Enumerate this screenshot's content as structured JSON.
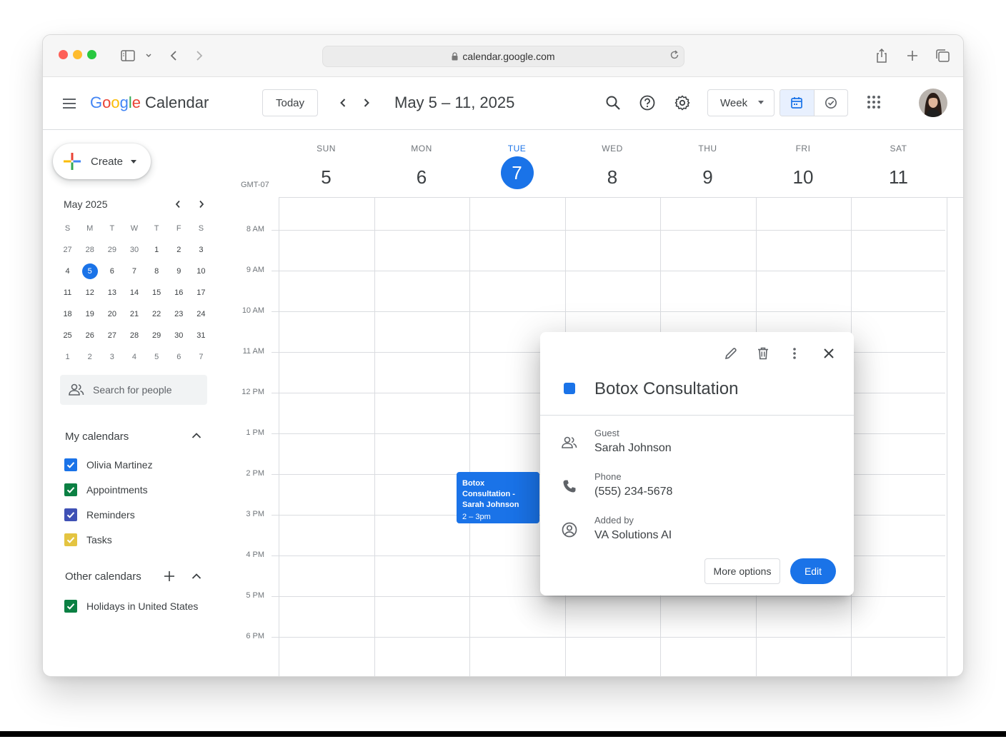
{
  "browser": {
    "url": "calendar.google.com"
  },
  "app": {
    "logo_letters": [
      "G",
      "o",
      "o",
      "g",
      "l",
      "e"
    ],
    "logo_colors": [
      "#4285F4",
      "#EA4335",
      "#FBBC05",
      "#4285F4",
      "#34A853",
      "#EA4335"
    ],
    "product": "Calendar",
    "accent": "#1a73e8"
  },
  "header": {
    "today_label": "Today",
    "date_range": "May 5 – 11, 2025",
    "view_label": "Week",
    "icons": [
      "menu-icon",
      "search-icon",
      "help-icon",
      "settings-icon",
      "calendar-view-icon",
      "tasks-view-icon",
      "apps-icon"
    ]
  },
  "sidebar": {
    "create_label": "Create",
    "mini_month": "May 2025",
    "mini_day_headers": [
      "S",
      "M",
      "T",
      "W",
      "T",
      "F",
      "S"
    ],
    "mini_weeks": [
      [
        "27",
        "28",
        "29",
        "30",
        "1",
        "2",
        "3"
      ],
      [
        "4",
        "5",
        "6",
        "7",
        "8",
        "9",
        "10"
      ],
      [
        "11",
        "12",
        "13",
        "14",
        "15",
        "16",
        "17"
      ],
      [
        "18",
        "19",
        "20",
        "21",
        "22",
        "23",
        "24"
      ],
      [
        "25",
        "26",
        "27",
        "28",
        "29",
        "30",
        "31"
      ],
      [
        "1",
        "2",
        "3",
        "4",
        "5",
        "6",
        "7"
      ]
    ],
    "mini_selected": "5",
    "people_placeholder": "Search for people",
    "my_calendars_title": "My calendars",
    "my_calendars": [
      {
        "name": "Olivia Martinez",
        "color": "#1a73e8"
      },
      {
        "name": "Appointments",
        "color": "#0b8043"
      },
      {
        "name": "Reminders",
        "color": "#3f51b5"
      },
      {
        "name": "Tasks",
        "color": "#e4c441"
      }
    ],
    "other_calendars_title": "Other calendars",
    "other_calendars": [
      {
        "name": "Holidays in United States",
        "color": "#0b8043"
      }
    ]
  },
  "week": {
    "timezone": "GMT-07",
    "days": [
      {
        "name": "SUN",
        "num": "5"
      },
      {
        "name": "MON",
        "num": "6"
      },
      {
        "name": "TUE",
        "num": "7",
        "today": true
      },
      {
        "name": "WED",
        "num": "8"
      },
      {
        "name": "THU",
        "num": "9"
      },
      {
        "name": "FRI",
        "num": "10"
      },
      {
        "name": "SAT",
        "num": "11"
      }
    ],
    "hours": [
      "8 AM",
      "9 AM",
      "10 AM",
      "11 AM",
      "12 PM",
      "1 PM",
      "2 PM",
      "3 PM",
      "4 PM",
      "5 PM",
      "6 PM"
    ]
  },
  "event": {
    "title_line1": "Botox Consultation -",
    "title_line2": "Sarah Johnson",
    "time": "2 – 3pm"
  },
  "popover": {
    "title": "Botox Consultation",
    "guest_label": "Guest",
    "guest_value": "Sarah Johnson",
    "phone_label": "Phone",
    "phone_value": "(555) 234-5678",
    "added_label": "Added by",
    "added_value": "VA Solutions AI",
    "more_label": "More options",
    "edit_label": "Edit"
  }
}
